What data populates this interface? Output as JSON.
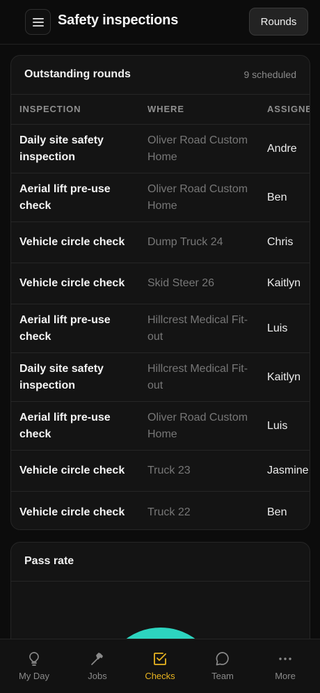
{
  "header": {
    "title": "Safety inspections",
    "rounds_label": "Rounds",
    "menu_icon": "hamburger-menu-icon"
  },
  "outstanding": {
    "title": "Outstanding rounds",
    "count_label": "9 scheduled",
    "columns": [
      "INSPECTION",
      "WHERE",
      "ASSIGNE"
    ],
    "rows": [
      {
        "inspection": "Daily site safety inspection",
        "where": "Oliver Road Custom Home",
        "assignee": "Andre"
      },
      {
        "inspection": "Aerial lift pre-use check",
        "where": "Oliver Road Custom Home",
        "assignee": "Ben"
      },
      {
        "inspection": "Vehicle circle check",
        "where": "Dump Truck 24",
        "assignee": "Chris"
      },
      {
        "inspection": "Vehicle circle check",
        "where": "Skid Steer 26",
        "assignee": "Kaitlyn"
      },
      {
        "inspection": "Aerial lift pre-use check",
        "where": "Hillcrest Medical Fit-out",
        "assignee": "Luis"
      },
      {
        "inspection": "Daily site safety inspection",
        "where": "Hillcrest Medical Fit-out",
        "assignee": "Kaitlyn"
      },
      {
        "inspection": "Aerial lift pre-use check",
        "where": "Oliver Road Custom Home",
        "assignee": "Luis"
      },
      {
        "inspection": "Vehicle circle check",
        "where": "Truck 23",
        "assignee": "Jasmine"
      },
      {
        "inspection": "Vehicle circle check",
        "where": "Truck 22",
        "assignee": "Ben"
      }
    ]
  },
  "pass_rate": {
    "title": "Pass rate",
    "gauge_color": "#2dd4bf"
  },
  "nav": {
    "items": [
      {
        "label": "My Day",
        "icon": "lightbulb-icon",
        "active": false
      },
      {
        "label": "Jobs",
        "icon": "hammer-icon",
        "active": false
      },
      {
        "label": "Checks",
        "icon": "checkbox-icon",
        "active": true
      },
      {
        "label": "Team",
        "icon": "chat-bubble-icon",
        "active": false
      },
      {
        "label": "More",
        "icon": "more-dots-icon",
        "active": false
      }
    ],
    "active_color": "#e9b420"
  }
}
